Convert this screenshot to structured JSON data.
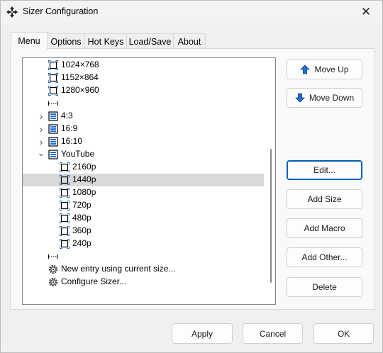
{
  "window": {
    "title": "Sizer Configuration"
  },
  "tabs": [
    {
      "label": "Menu"
    },
    {
      "label": "Options"
    },
    {
      "label": "Hot Keys"
    },
    {
      "label": "Load/Save"
    },
    {
      "label": "About"
    }
  ],
  "tree": {
    "items": [
      {
        "label": "1024×768",
        "icon": "size-icon",
        "expander": ""
      },
      {
        "label": "1152×864",
        "icon": "size-icon",
        "expander": ""
      },
      {
        "label": "1280×960",
        "icon": "size-icon",
        "expander": ""
      },
      {
        "label": "",
        "icon": "separator-icon",
        "expander": ""
      },
      {
        "label": "4:3",
        "icon": "folder-list-icon",
        "expander": "collapsed"
      },
      {
        "label": "16:9",
        "icon": "folder-list-icon",
        "expander": "collapsed"
      },
      {
        "label": "16:10",
        "icon": "folder-list-icon",
        "expander": "collapsed"
      },
      {
        "label": "YouTube",
        "icon": "folder-list-icon",
        "expander": "expanded"
      },
      {
        "label": "2160p",
        "icon": "size-icon",
        "expander": ""
      },
      {
        "label": "1440p",
        "icon": "size-icon",
        "expander": "",
        "selected": true
      },
      {
        "label": "1080p",
        "icon": "size-icon",
        "expander": ""
      },
      {
        "label": "720p",
        "icon": "size-icon",
        "expander": ""
      },
      {
        "label": "480p",
        "icon": "size-icon",
        "expander": ""
      },
      {
        "label": "360p",
        "icon": "size-icon",
        "expander": ""
      },
      {
        "label": "240p",
        "icon": "size-icon",
        "expander": ""
      },
      {
        "label": "",
        "icon": "separator-icon",
        "expander": ""
      },
      {
        "label": "New entry using current size...",
        "icon": "gear-icon",
        "expander": ""
      },
      {
        "label": "Configure Sizer...",
        "icon": "gear-icon",
        "expander": ""
      }
    ]
  },
  "side_buttons": {
    "move_up": "Move Up",
    "move_down": "Move Down",
    "edit": "Edit...",
    "add_size": "Add Size",
    "add_macro": "Add Macro",
    "add_other": "Add Other...",
    "delete": "Delete"
  },
  "footer": {
    "apply": "Apply",
    "cancel": "Cancel",
    "ok": "OK"
  },
  "colors": {
    "accent": "#005fb8",
    "selection": "#d9d9d9",
    "arrow_blue": "#1f6fd6"
  }
}
